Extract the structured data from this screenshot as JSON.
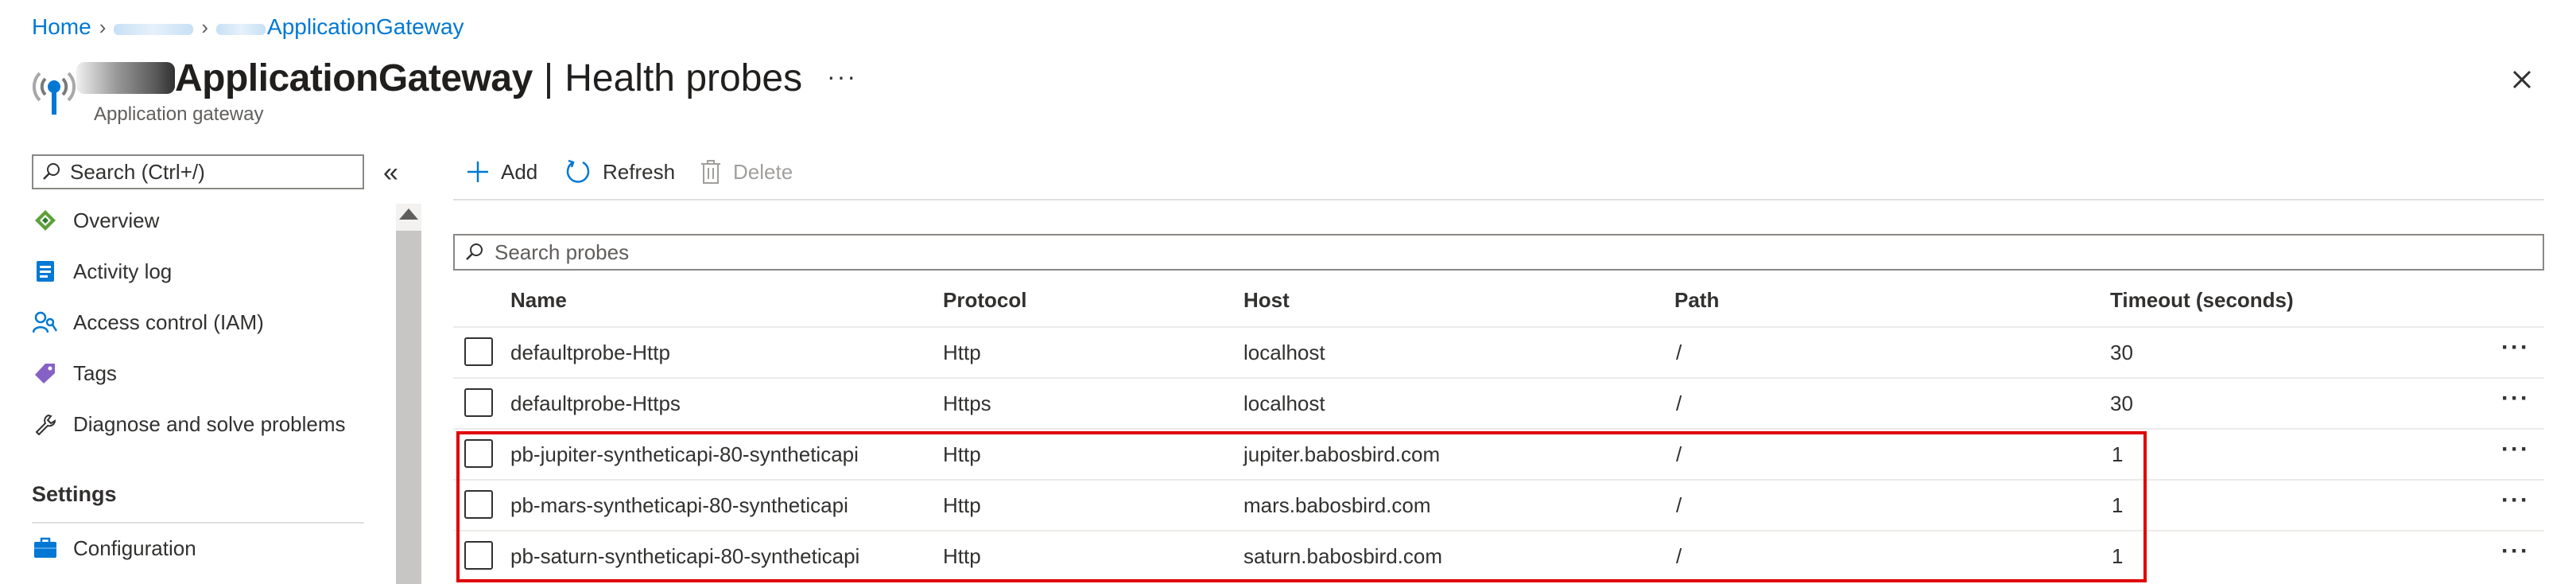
{
  "breadcrumb": {
    "home": "Home",
    "current": "ApplicationGateway"
  },
  "header": {
    "title": "ApplicationGateway",
    "separator": "|",
    "section": "Health probes",
    "subtitle": "Application gateway",
    "more": "···"
  },
  "nav": {
    "search_placeholder": "Search (Ctrl+/)",
    "collapse": "«",
    "items": [
      {
        "label": "Overview",
        "icon": "overview-icon"
      },
      {
        "label": "Activity log",
        "icon": "activity-log-icon"
      },
      {
        "label": "Access control (IAM)",
        "icon": "iam-icon"
      },
      {
        "label": "Tags",
        "icon": "tag-icon"
      },
      {
        "label": "Diagnose and solve problems",
        "icon": "wrench-icon"
      }
    ],
    "settings_heading": "Settings",
    "settings_items": [
      {
        "label": "Configuration",
        "icon": "configuration-icon"
      }
    ]
  },
  "toolbar": {
    "add_label": "Add",
    "refresh_label": "Refresh",
    "delete_label": "Delete"
  },
  "probe_search": {
    "placeholder": "Search probes"
  },
  "table": {
    "columns": [
      "Name",
      "Protocol",
      "Host",
      "Path",
      "Timeout (seconds)"
    ],
    "rows": [
      {
        "name": "defaultprobe-Http",
        "protocol": "Http",
        "host": "localhost",
        "path": "/",
        "timeout": "30"
      },
      {
        "name": "defaultprobe-Https",
        "protocol": "Https",
        "host": "localhost",
        "path": "/",
        "timeout": "30"
      },
      {
        "name": "pb-jupiter-syntheticapi-80-syntheticapi",
        "protocol": "Http",
        "host": "jupiter.babosbird.com",
        "path": "/",
        "timeout": "1"
      },
      {
        "name": "pb-mars-syntheticapi-80-syntheticapi",
        "protocol": "Http",
        "host": "mars.babosbird.com",
        "path": "/",
        "timeout": "1"
      },
      {
        "name": "pb-saturn-syntheticapi-80-syntheticapi",
        "protocol": "Http",
        "host": "saturn.babosbird.com",
        "path": "/",
        "timeout": "1"
      }
    ],
    "row_more": "···"
  },
  "colors": {
    "accent": "#0078d4",
    "highlight": "#e00000",
    "text": "#323130"
  }
}
